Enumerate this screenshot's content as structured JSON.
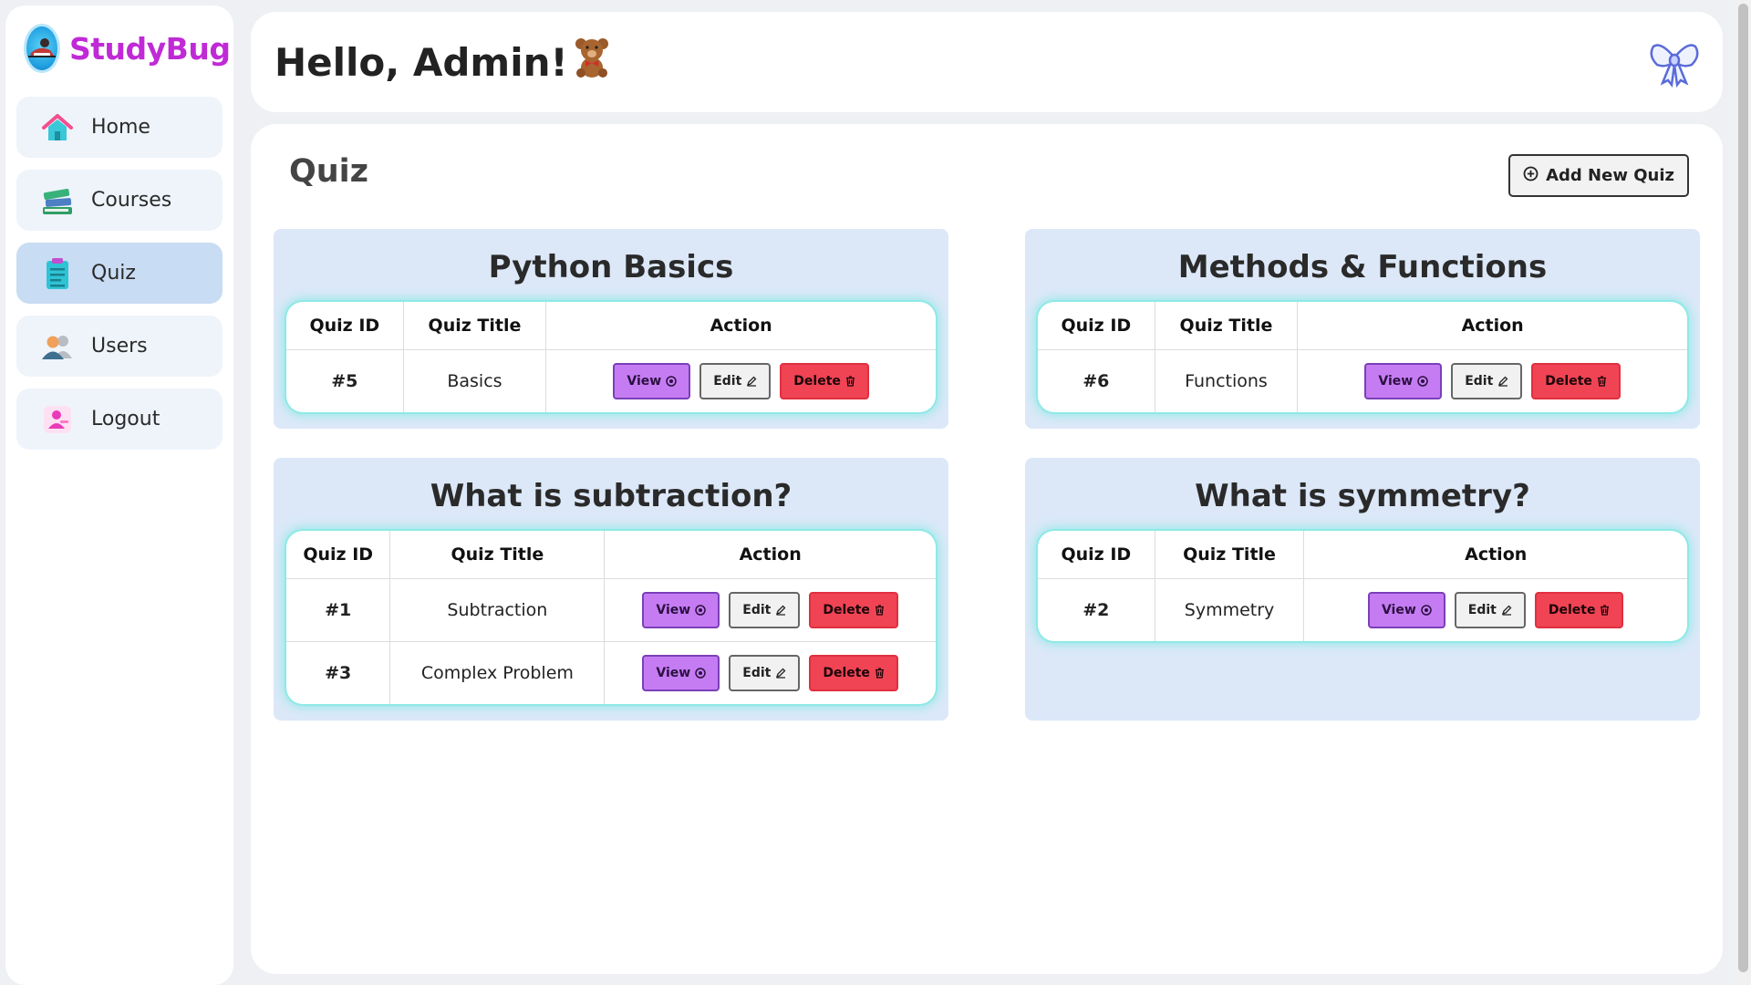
{
  "brand": {
    "name": "StudyBug",
    "logo_icon": "person-reading-logo-icon"
  },
  "sidebar": {
    "items": [
      {
        "label": "Home",
        "icon": "house-icon",
        "active": false
      },
      {
        "label": "Courses",
        "icon": "books-icon",
        "active": false
      },
      {
        "label": "Quiz",
        "icon": "clipboard-icon",
        "active": true
      },
      {
        "label": "Users",
        "icon": "users-icon",
        "active": false
      },
      {
        "label": "Logout",
        "icon": "logout-user-icon",
        "active": false
      }
    ]
  },
  "header": {
    "greeting": "Hello, Admin!",
    "greeting_icon": "teddy-bear-icon",
    "corner_icon": "bow-icon"
  },
  "main": {
    "title": "Quiz",
    "add_button_label": "Add New Quiz",
    "columns": {
      "id": "Quiz ID",
      "title": "Quiz Title",
      "action": "Action"
    },
    "buttons": {
      "view": "View",
      "edit": "Edit",
      "delete": "Delete"
    },
    "cards": [
      {
        "title": "Python Basics",
        "rows": [
          {
            "id": "#5",
            "title": "Basics"
          }
        ]
      },
      {
        "title": "Methods & Functions",
        "rows": [
          {
            "id": "#6",
            "title": "Functions"
          }
        ]
      },
      {
        "title": "What is subtraction?",
        "rows": [
          {
            "id": "#1",
            "title": "Subtraction"
          },
          {
            "id": "#3",
            "title": "Complex Problem"
          }
        ]
      },
      {
        "title": "What is symmetry?",
        "rows": [
          {
            "id": "#2",
            "title": "Symmetry"
          }
        ]
      }
    ]
  },
  "colors": {
    "brand": "#c02ad6",
    "view": "#c57cf3",
    "delete": "#f04454",
    "card_bg": "#dce8f8",
    "table_glow": "#8ee9e6",
    "active_nav": "#c8dcf3"
  }
}
